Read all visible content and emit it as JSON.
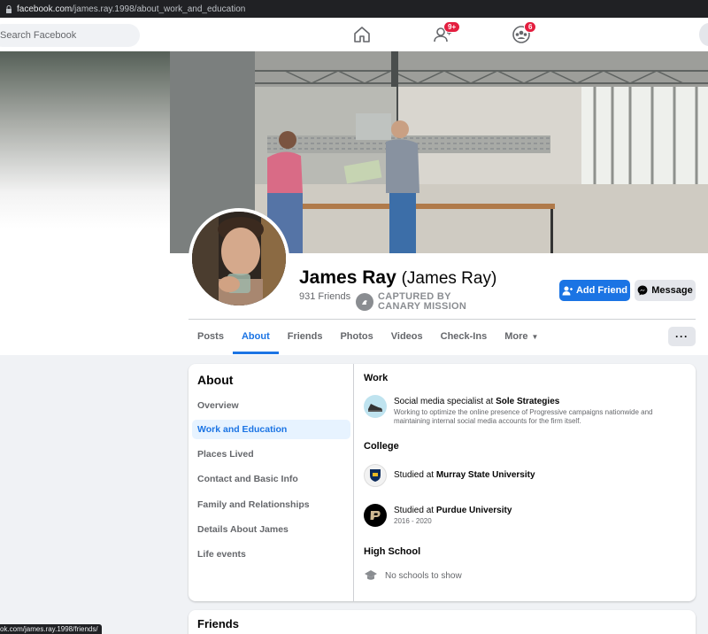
{
  "browser": {
    "url_host": "facebook.com",
    "url_path": "/james.ray.1998/about_work_and_education",
    "status_url": "ok.com/james.ray.1998/friends/"
  },
  "topnav": {
    "search_placeholder": "Search Facebook",
    "friends_badge": "9+",
    "groups_badge": "6"
  },
  "profile": {
    "name": "James Ray",
    "alt_name": "(James Ray)",
    "friends_count": "931 Friends",
    "stamp_line1": "CAPTURED BY",
    "stamp_line2": "CANARY MISSION",
    "add_friend_label": "Add Friend",
    "message_label": "Message"
  },
  "tabs": [
    {
      "label": "Posts"
    },
    {
      "label": "About"
    },
    {
      "label": "Friends"
    },
    {
      "label": "Photos"
    },
    {
      "label": "Videos"
    },
    {
      "label": "Check-Ins"
    },
    {
      "label": "More"
    }
  ],
  "about": {
    "title": "About",
    "items": [
      {
        "label": "Overview"
      },
      {
        "label": "Work and Education"
      },
      {
        "label": "Places Lived"
      },
      {
        "label": "Contact and Basic Info"
      },
      {
        "label": "Family and Relationships"
      },
      {
        "label": "Details About James"
      },
      {
        "label": "Life events"
      }
    ]
  },
  "work": {
    "title": "Work",
    "prefix": "Social media specialist at ",
    "company": "Sole Strategies",
    "description": "Working to optimize the online presence of Progressive campaigns nationwide and maintaining internal social media accounts for the firm itself."
  },
  "college": {
    "title": "College",
    "entries": [
      {
        "prefix": "Studied at ",
        "school": "Murray State University",
        "years": ""
      },
      {
        "prefix": "Studied at ",
        "school": "Purdue University",
        "years": "2016 - 2020"
      }
    ]
  },
  "high_school": {
    "title": "High School",
    "empty_text": "No schools to show"
  },
  "friends_section": {
    "title": "Friends"
  },
  "colors": {
    "accent": "#1b74e4",
    "badge": "#e41e3f"
  }
}
